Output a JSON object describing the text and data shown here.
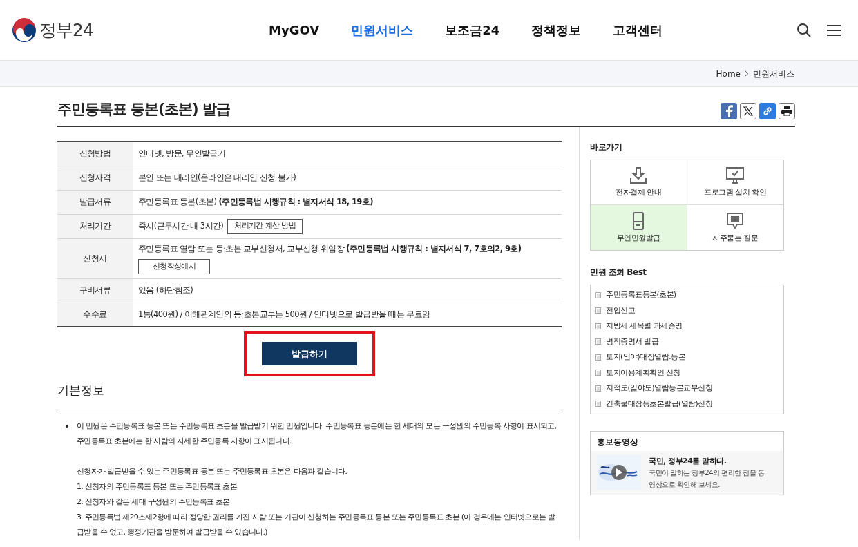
{
  "header": {
    "logo_text": "정부24",
    "nav": [
      {
        "label": "MyGOV",
        "selected": false
      },
      {
        "label": "민원서비스",
        "selected": true
      },
      {
        "label": "보조금24",
        "selected": false
      },
      {
        "label": "정책정보",
        "selected": false
      },
      {
        "label": "고객센터",
        "selected": false
      }
    ]
  },
  "breadcrumb": [
    "Home",
    "민원서비스"
  ],
  "page_title": "주민등록표 등본(초본) 발급",
  "share_icons": [
    {
      "kind": "facebook"
    },
    {
      "kind": "x"
    },
    {
      "kind": "link"
    },
    {
      "kind": "print"
    }
  ],
  "info_table": [
    {
      "label": "신청방법",
      "value": "인터넷, 방문, 무인발급기"
    },
    {
      "label": "신청자격",
      "value": "본인 또는 대리인(온라인은 대리인 신청 불가)"
    },
    {
      "label": "발급서류",
      "value": "주민등록표 등본(초본) **(주민등록법 시행규칙 : 별지서식 18, 19호)**"
    },
    {
      "label": "처리기간",
      "value": "즉시(근무시간 내 3시간)",
      "button": "처리기간 계산 방법",
      "button_below": false
    },
    {
      "label": "신청서",
      "value": "주민등록표 열람 또는 등·초본 교부신청서, 교부신청 위임장 **(주민등록법 시행규칙 : 별지서식 7, 7호의2, 9호)**",
      "button": "신청작성예시",
      "button_below": true
    },
    {
      "label": "구비서류",
      "value": "있음 (하단참조)"
    },
    {
      "label": "수수료",
      "value": "1통(400원) / 이해관계인의 등·초본교부는 500원 / 인터넷으로 발급받을 때는 무료임"
    }
  ],
  "issue_button": {
    "label": "발급하기",
    "highlighted": true
  },
  "basic_info": {
    "title": "기본정보",
    "intro": "이 민원은 주민등록표 등본 또는 주민등록표 초본을 발급받기 위한 민원입니다. 주민등록표 등본에는 한 세대의 모든 구성원의 주민등록 사항이 표시되고, 주민등록표 초본에는 한 사람의 자세한 주민등록 사항이 표시됩니다.",
    "lines": [
      "신청자가 발급받을 수 있는 주민등록표 등본 또는 주민등록표 초본은 다음과 같습니다.",
      "1. 신청자의 주민등록표 등본 또는 주민등록표 초본",
      "2. 신청자와 같은 세대 구성원의 주민등록표 초본",
      "3. 주민등록법 제29조제2항에 따라 정당한 권리를 가진 사람 또는 기관이 신청하는 주민등록표 등본 또는 주민등록표 초본 (이 경우에는 인터넷으로는 발급받을 수 없고, 행정기관을 방문하여 발급받을 수 있습니다.)"
    ]
  },
  "quick_links": {
    "title": "바로가기",
    "items": [
      {
        "label": "전자결제 안내",
        "kind": "download",
        "selected": false
      },
      {
        "label": "프로그램 설치 확인",
        "kind": "monitor",
        "selected": false
      },
      {
        "label": "무인민원발급",
        "kind": "kiosk",
        "selected": true
      },
      {
        "label": "자주묻는 질문",
        "kind": "chat",
        "selected": false
      }
    ]
  },
  "best": {
    "title": "민원 조회 Best",
    "items": [
      "주민등록표등본(초본)",
      "전입신고",
      "지방세 세목별 과세증명",
      "병적증명서 발급",
      "토지(임야)대장열람.등본",
      "토지이용계획확인 신청",
      "지적도(임야도)열람등본교부신청",
      "건축물대장등초본발급(열람)신청"
    ]
  },
  "promo": {
    "title": "홍보동영상",
    "headline": "국민, 정부24를 말하다.",
    "description": "국민이 말하는 정부24의 편리한 점을 동영상으로 확인해 보세요."
  }
}
